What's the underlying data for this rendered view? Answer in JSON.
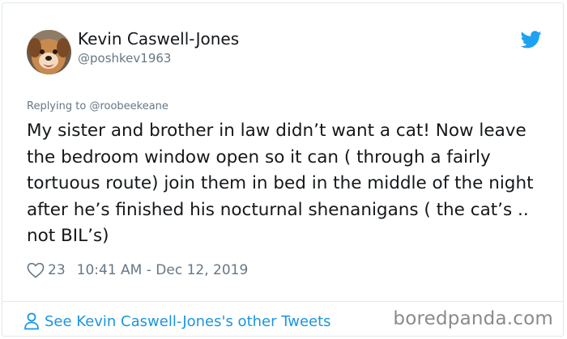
{
  "author": {
    "name": "Kevin Caswell-Jones",
    "handle": "@poshkev1963",
    "avatar": "dog-photo"
  },
  "brand_icon": "twitter-bird-icon",
  "colors": {
    "brand_blue": "#1da1f2",
    "link_blue": "#1b95e0",
    "text": "#14171a",
    "muted": "#657786",
    "border": "#e1e8ed"
  },
  "reply": {
    "prefix": "Replying to",
    "handle": "@roobeekeane"
  },
  "tweet": {
    "text": "My sister and brother in law didn’t want a cat! Now leave the bedroom window open so it can ( through a fairly tortuous route) join them in bed in the middle of the night after he’s finished his nocturnal shenanigans ( the cat’s .. not BIL’s)",
    "likes": "23",
    "timestamp": "10:41 AM - Dec 12, 2019"
  },
  "footer": {
    "link_label": "See Kevin Caswell-Jones's other Tweets",
    "link_icon": "person-icon",
    "watermark": "boredpanda.com"
  }
}
